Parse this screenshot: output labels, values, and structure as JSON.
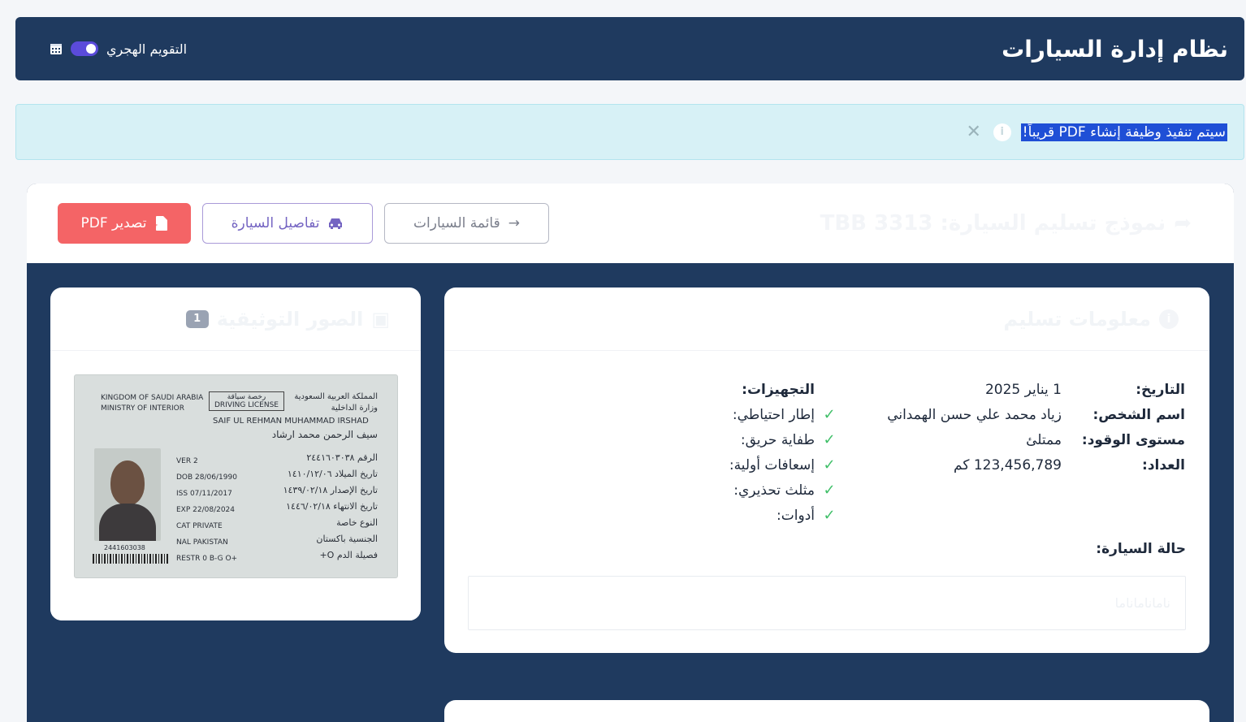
{
  "header": {
    "app_title": "نظام إدارة السيارات",
    "hijri_label": "التقويم الهجري",
    "hijri_enabled": true
  },
  "alert": {
    "message": "سيتم تنفيذ وظيفة إنشاء PDF قريباً!",
    "close_glyph": "✕",
    "info_glyph": "i"
  },
  "page": {
    "title": "نموذج تسليم السيارة: TBB 3313",
    "actions": {
      "export_pdf": "تصدير PDF",
      "car_details": "تفاصيل السيارة",
      "car_list": "قائمة السيارات"
    }
  },
  "delivery": {
    "title": "معلومات تسليم",
    "fields": [
      {
        "key": "التاريخ:",
        "value": "1 يناير 2025"
      },
      {
        "key": "اسم الشخص:",
        "value": "زياد محمد علي حسن الهمداني"
      },
      {
        "key": "مستوى الوقود:",
        "value": "ممتلئ"
      },
      {
        "key": "العداد:",
        "value": "123,456,789 كم"
      }
    ],
    "equipment_title": "التجهيزات:",
    "equipment": [
      {
        "label": "إطار احتياطي:",
        "checked": true
      },
      {
        "label": "طفاية حريق:",
        "checked": true
      },
      {
        "label": "إسعافات أولية:",
        "checked": true
      },
      {
        "label": "مثلث تحذيري:",
        "checked": true
      },
      {
        "label": "أدوات:",
        "checked": true
      }
    ],
    "check_glyph": "✓",
    "condition_title": "حالة السيارة:",
    "condition_value": "ناماناماناما"
  },
  "photos": {
    "title": "الصور التوثيقية",
    "count": "1",
    "license": {
      "en_header": [
        "KINGDOM OF SAUDI ARABIA",
        "MINISTRY OF INTERIOR"
      ],
      "ar_header": [
        "المملكة العربية السعودية",
        "وزارة الداخلية"
      ],
      "doc_type_ar": "رخصة سياقة",
      "doc_type_en": "DRIVING LICENSE",
      "name_en": "SAIF UL REHMAN MUHAMMAD IRSHAD",
      "name_ar": "سيف الرحمن محمد ارشاد",
      "fields_en": [
        "VER  2",
        "DOB  28/06/1990",
        "ISS  07/11/2017",
        "EXP  22/08/2024",
        "CAT  PRIVATE",
        "NAL  PAKISTAN",
        "RESTR  0      B-G  O+"
      ],
      "fields_ar": [
        "الرقم  ٢٤٤١٦٠٣٠٣٨",
        "تاريخ الميلاد  ١٤١٠/١٢/٠٦",
        "تاريخ الإصدار  ١٤٣٩/٠٢/١٨",
        "تاريخ الانتهاء  ١٤٤٦/٠٢/١٨",
        "النوع  خاصة",
        "الجنسية  باكستان",
        "فصيلة الدم  O+"
      ],
      "barcode_number": "2441603038"
    }
  },
  "colors": {
    "header_bg": "#1f3a5f",
    "alert_bg": "#d7f1f6",
    "pdf_button": "#f46466",
    "details_button_border": "#a99ad8",
    "check": "#3fbf68"
  }
}
